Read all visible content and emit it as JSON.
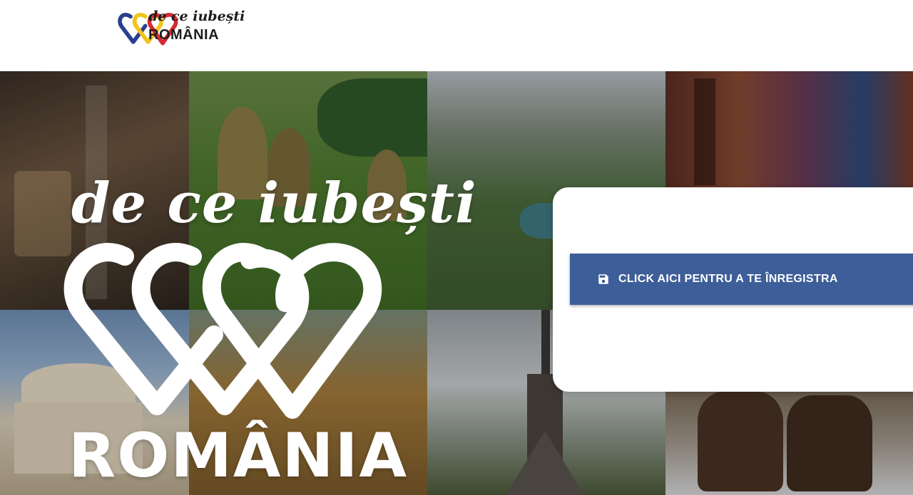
{
  "header": {
    "logo_line1": "de ce iubești",
    "logo_line2": "ROMÂNIA"
  },
  "hero": {
    "script_text": "de ce iubești",
    "word_text": "ROMÂNIA"
  },
  "card": {
    "register_label": "CLICK AICI PENTRU A TE ÎNREGISTRA",
    "register_icon": "save-icon"
  },
  "colors": {
    "button": "#3d5e99",
    "heart_blue": "#2b3f8f",
    "heart_yellow": "#f2c318",
    "heart_red": "#d62a33"
  }
}
